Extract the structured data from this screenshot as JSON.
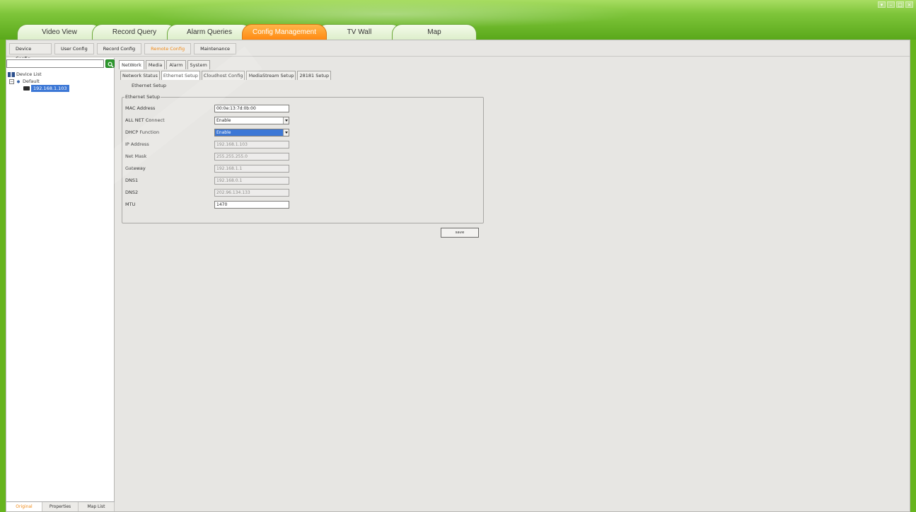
{
  "main_tabs": [
    {
      "label": "Video View",
      "active": false
    },
    {
      "label": "Record Query",
      "active": false
    },
    {
      "label": "Alarm Queries",
      "active": false
    },
    {
      "label": "Config Management",
      "active": true
    },
    {
      "label": "TV Wall",
      "active": false
    },
    {
      "label": "Map",
      "active": false
    }
  ],
  "sub_tabs": [
    {
      "label": "Device Config",
      "active": false
    },
    {
      "label": "User Config",
      "active": false
    },
    {
      "label": "Record Config",
      "active": false
    },
    {
      "label": "Remote Config",
      "active": true
    },
    {
      "label": "Maintenance",
      "active": false
    }
  ],
  "left_panel": {
    "search_placeholder": "",
    "tree": {
      "root": "Device List",
      "group": "Default",
      "device": "192.168.1.103"
    },
    "bottom_tabs": [
      {
        "label": "Original",
        "active": true
      },
      {
        "label": "Properties",
        "active": false
      },
      {
        "label": "Map List",
        "active": false
      }
    ]
  },
  "section_tabs": [
    {
      "label": "NetWork",
      "active": true
    },
    {
      "label": "Media",
      "active": false
    },
    {
      "label": "Alarm",
      "active": false
    },
    {
      "label": "System",
      "active": false
    }
  ],
  "network_tabs": [
    {
      "label": "Network Status",
      "active": false
    },
    {
      "label": "Ethernet Setup",
      "active": true
    },
    {
      "label": "Cloudhost Config",
      "active": false
    },
    {
      "label": "MediaStream Setup",
      "active": false
    },
    {
      "label": "28181 Setup",
      "active": false
    }
  ],
  "inner_tab_label": "Ethernet Setup",
  "form": {
    "group_title": "Ethernet Setup",
    "fields": [
      {
        "label": "MAC Address",
        "value": "00:0e:13:7d:0b:00"
      },
      {
        "label": "ALL NET Connect",
        "value": "Enable"
      },
      {
        "label": "DHCP Function",
        "value": "Enable"
      },
      {
        "label": "IP Address",
        "value": "192.168.1.103"
      },
      {
        "label": "Net Mask",
        "value": "255.255.255.0"
      },
      {
        "label": "Gateway",
        "value": "192.168.1.1"
      },
      {
        "label": "DNS1",
        "value": "192.168.0.1"
      },
      {
        "label": "DNS2",
        "value": "202.96.134.133"
      },
      {
        "label": "MTU",
        "value": "1470"
      }
    ],
    "save_label": "save"
  },
  "colors": {
    "frame_green": "#66b41e",
    "active_tab_orange": "#ff8a12",
    "selection_blue": "#3d78d6",
    "active_subtab_text": "#f08a16"
  },
  "window_controls": [
    "minimize-icon",
    "restore-icon",
    "maximize-icon",
    "close-icon"
  ]
}
